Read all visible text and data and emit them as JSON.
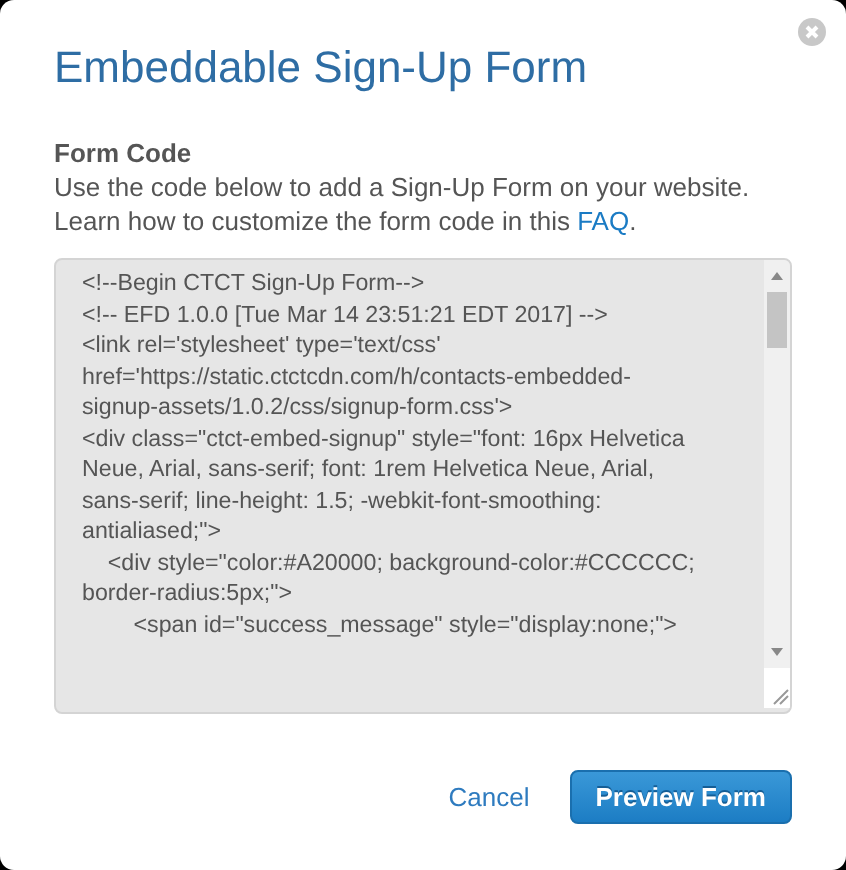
{
  "dialog": {
    "title": "Embeddable Sign-Up Form",
    "section_heading": "Form Code",
    "description": "Use the code below to add a Sign-Up Form on your website.",
    "help_text": "Learn how to customize the form code in this ",
    "help_link": "FAQ",
    "help_suffix": ".",
    "code_lines": [
      "<!--Begin CTCT Sign-Up Form-->",
      "<!-- EFD 1.0.0 [Tue Mar 14 23:51:21 EDT 2017] -->",
      "<link rel='stylesheet' type='text/css'",
      "href='https://static.ctctcdn.com/h/contacts-embedded-",
      "signup-assets/1.0.2/css/signup-form.css'>",
      "<div class=\"ctct-embed-signup\" style=\"font: 16px Helvetica",
      "Neue, Arial, sans-serif; font: 1rem Helvetica Neue, Arial,",
      "sans-serif; line-height: 1.5; -webkit-font-smoothing:",
      "antialiased;\">",
      "    <div style=\"color:#A20000; background-color:#CCCCCC;",
      "border-radius:5px;\">",
      "        <span id=\"success_message\" style=\"display:none;\">"
    ],
    "buttons": [
      {
        "label": "Cancel",
        "kind": "link"
      },
      {
        "label": "Preview Form",
        "kind": "primary"
      }
    ]
  }
}
